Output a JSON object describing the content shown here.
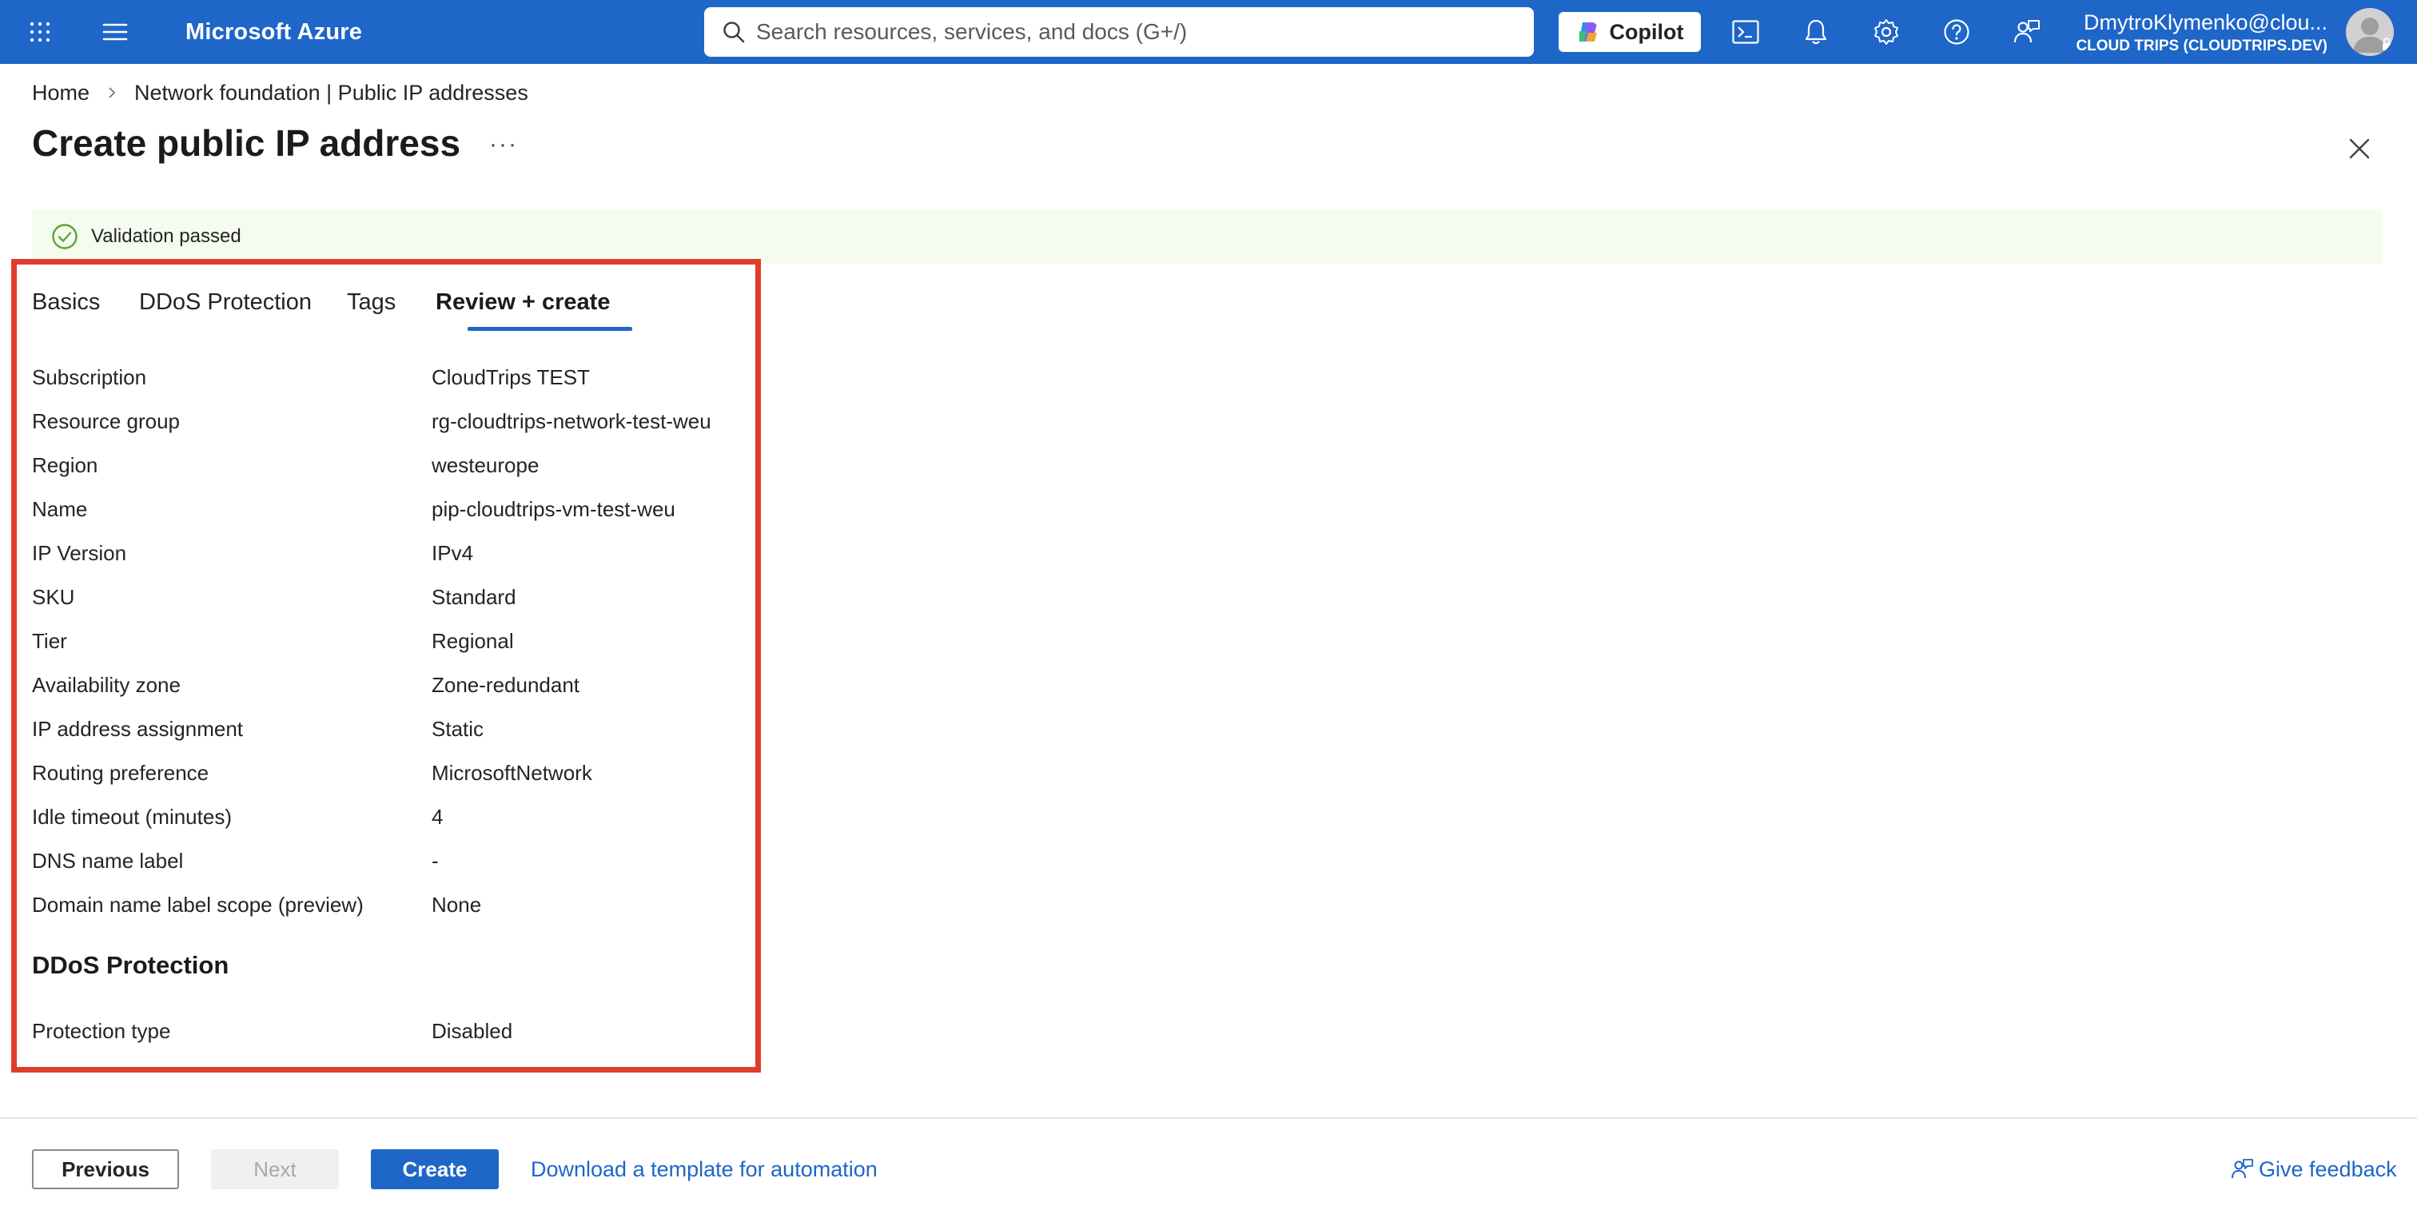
{
  "header": {
    "brand": "Microsoft Azure",
    "search_placeholder": "Search resources, services, and docs (G+/)",
    "copilot_label": "Copilot",
    "account_email": "DmytroKlymenko@clou...",
    "account_directory": "CLOUD TRIPS (CLOUDTRIPS.DEV)"
  },
  "breadcrumb": {
    "items": [
      "Home",
      "Network foundation | Public IP addresses"
    ]
  },
  "page": {
    "title": "Create public IP address",
    "more_label": "···"
  },
  "validation": {
    "message": "Validation passed",
    "status_color": "#5fa33a"
  },
  "tabs": [
    {
      "label": "Basics"
    },
    {
      "label": "DDoS Protection"
    },
    {
      "label": "Tags"
    },
    {
      "label": "Review + create",
      "active": true
    }
  ],
  "review": {
    "rows": [
      {
        "label": "Subscription",
        "value": "CloudTrips TEST"
      },
      {
        "label": "Resource group",
        "value": "rg-cloudtrips-network-test-weu"
      },
      {
        "label": "Region",
        "value": "westeurope"
      },
      {
        "label": "Name",
        "value": "pip-cloudtrips-vm-test-weu"
      },
      {
        "label": "IP Version",
        "value": "IPv4"
      },
      {
        "label": "SKU",
        "value": "Standard"
      },
      {
        "label": "Tier",
        "value": "Regional"
      },
      {
        "label": "Availability zone",
        "value": "Zone-redundant"
      },
      {
        "label": "IP address assignment",
        "value": "Static"
      },
      {
        "label": "Routing preference",
        "value": "MicrosoftNetwork"
      },
      {
        "label": "Idle timeout (minutes)",
        "value": "4"
      },
      {
        "label": "DNS name label",
        "value": "-"
      },
      {
        "label": "Domain name label scope (preview)",
        "value": "None"
      }
    ],
    "ddos_section_title": "DDoS Protection",
    "ddos_rows": [
      {
        "label": "Protection type",
        "value": "Disabled"
      }
    ]
  },
  "footer": {
    "previous_label": "Previous",
    "next_label": "Next",
    "create_label": "Create",
    "download_template_label": "Download a template for automation",
    "feedback_label": "Give feedback"
  },
  "colors": {
    "brand_bar": "#1e66c8",
    "highlight_border": "#e03c2a",
    "link": "#1e66c8"
  },
  "icons": [
    "app-launcher-icon",
    "menu-icon",
    "search-icon",
    "copilot-icon",
    "cloud-shell-icon",
    "bell-icon",
    "gear-icon",
    "help-icon",
    "feedback-person-icon",
    "avatar-icon",
    "chevron-right-icon",
    "close-icon",
    "check-circle-icon"
  ]
}
